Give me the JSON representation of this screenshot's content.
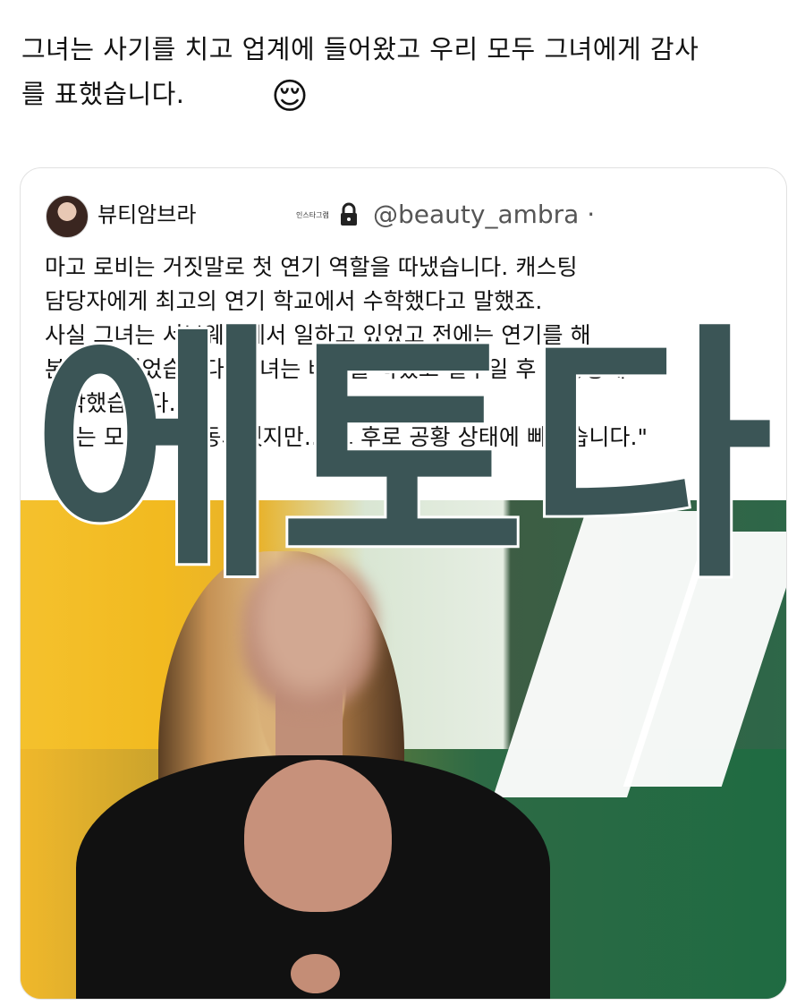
{
  "post": {
    "text_line_1": "그녀는 사기를 치고 업계에 들어왔고 우리 모두 그녀에게 감사",
    "text_line_2": "를 표했습니다.",
    "emoji": "😌"
  },
  "quoted_post": {
    "author_name": "뷰티암브라",
    "tiny_label": "인스타그램",
    "handle": "@beauty_ambra ·",
    "body_lines": [
      "마고 로비는 거짓말로 첫 연기 역할을 따냈습니다. 캐스팅",
      "담당자에게 최고의 연기 학교에서 수학했다고 말했죠.",
      "사실 그녀는 서브웨이에서 일하고 있었고 전에는 연기를 해",
      "본 적이 없었습니다. 그녀는 배역을 따냈고 일주일 후 촬영장에",
      "도착했습니다.",
      "\"저는 모든 것에 동의했지만... 그 후로 공황 상태에 빠졌습니다.\""
    ]
  },
  "media": {
    "watermark": "에토다"
  },
  "colors": {
    "card_border": "#e1e1e1",
    "watermark_fill": "#3b5556",
    "handle_gray": "#555555",
    "yellow": "#f2ba20",
    "green": "#2d6748"
  },
  "icons": {
    "lock": "lock-icon",
    "emoji": "relieved-face-icon"
  }
}
